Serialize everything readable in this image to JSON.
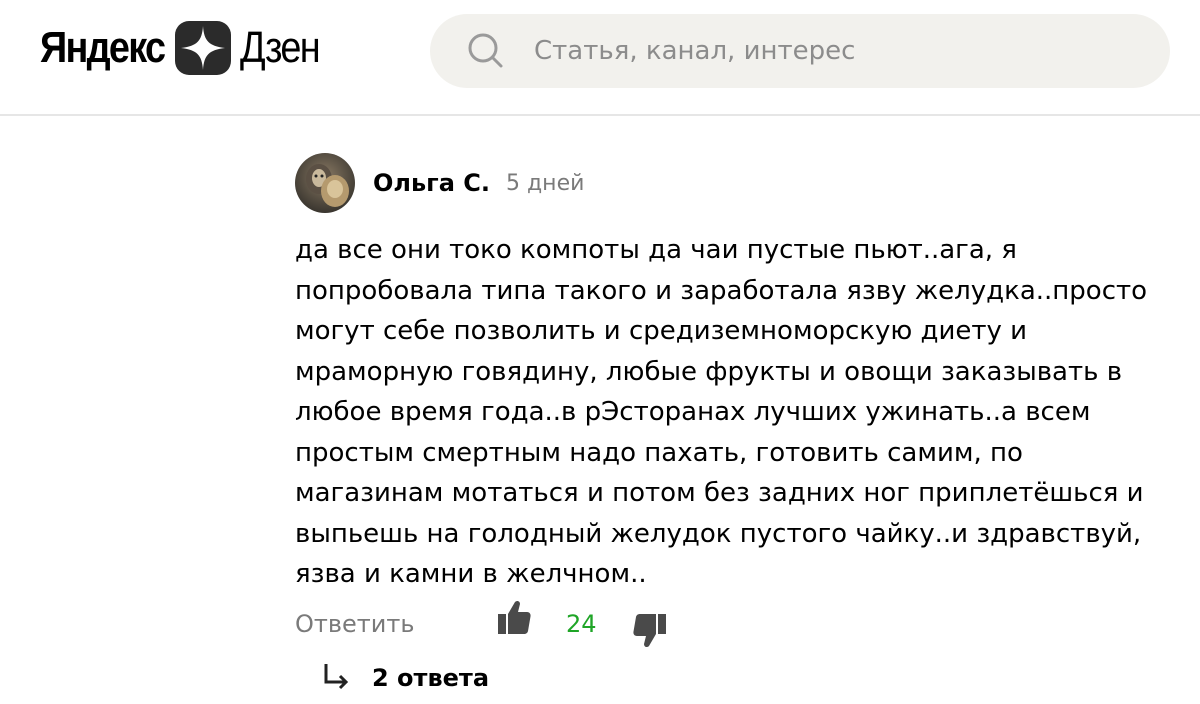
{
  "header": {
    "logo_left": "Яндекс",
    "logo_right": "Дзен",
    "search_placeholder": "Статья, канал, интерес"
  },
  "comment": {
    "author": "Ольга С.",
    "time": "5 дней",
    "text": "да все они токо компоты да чаи пустые пьют..ага, я попробовала типа такого и заработала язву желудка..просто могут себе позволить и средиземноморскую диету и мраморную говядину, любые фрукты и овощи заказывать в любое время года..в рЭсторанах лучших ужинать..а всем простым смертным надо пахать, готовить самим, по магазинам мотаться и потом без задних ног приплетёшься и выпьешь на голодный желудок пустого чайку..и здравствуй, язва и камни в желчном..",
    "reply_label": "Ответить",
    "like_count": "24",
    "replies_label": "2 ответа"
  },
  "colors": {
    "like_count": "#1fa527",
    "muted_text": "#7a7a7a",
    "search_bg": "#f2f1ed",
    "icon_dark": "#333333"
  },
  "icons": {
    "search": "search-icon",
    "like": "thumbs-up-icon",
    "dislike": "thumbs-down-icon",
    "replies": "reply-arrow-icon",
    "logo": "zen-star-logo-icon"
  }
}
